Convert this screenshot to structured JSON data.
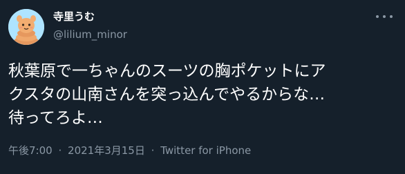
{
  "user": {
    "display_name": "寺里うむ",
    "handle": "@lilium_minor",
    "avatar_icon": "cartoon-character-avatar"
  },
  "tweet": {
    "lines": [
      "秋葉原で一ちゃんのスーツの胸ポケットにア",
      "クスタの山南さんを突っ込んでやるからな…",
      "待ってろよ…"
    ]
  },
  "meta": {
    "time": "午後7:00",
    "separator": "·",
    "date": "2021年3月15日",
    "source": "Twitter for iPhone"
  },
  "menu": {
    "icon": "more-options-icon"
  },
  "colors": {
    "background": "#15202b",
    "text_primary": "#ffffff",
    "text_secondary": "#8b98a5",
    "avatar_bg": "#aee4ff"
  }
}
